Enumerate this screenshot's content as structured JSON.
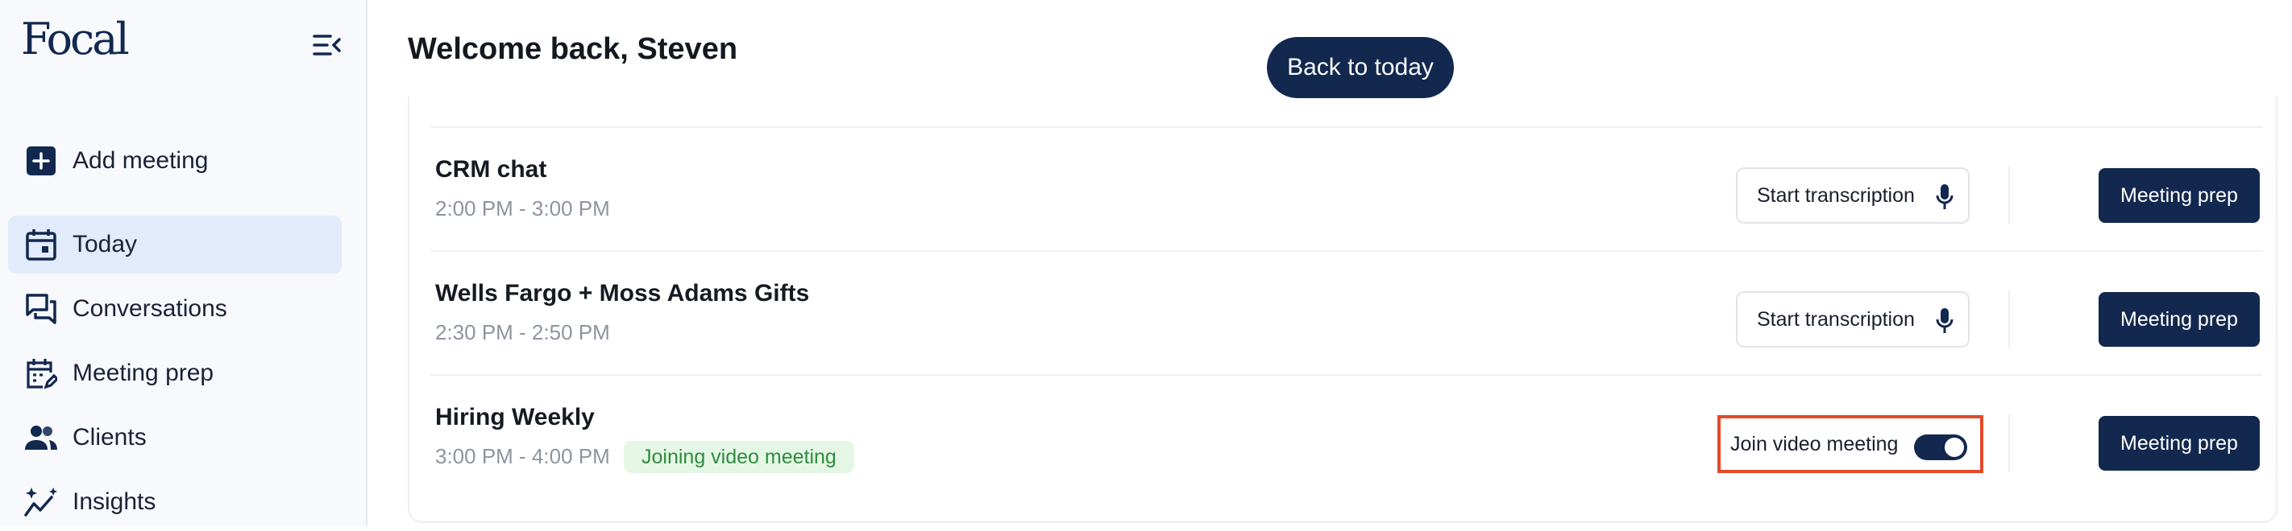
{
  "app": {
    "logo_text": "Focal"
  },
  "sidebar": {
    "items": [
      {
        "label": "Add meeting",
        "icon": "plus-square-icon"
      },
      {
        "label": "Today",
        "icon": "calendar-icon",
        "active": true
      },
      {
        "label": "Conversations",
        "icon": "chat-icon"
      },
      {
        "label": "Meeting prep",
        "icon": "calendar-edit-icon"
      },
      {
        "label": "Clients",
        "icon": "users-icon"
      },
      {
        "label": "Insights",
        "icon": "sparkle-chart-icon"
      }
    ]
  },
  "header": {
    "title": "Welcome back, Steven",
    "back_button": "Back to today"
  },
  "meetings": [
    {
      "title": "CRM chat",
      "time": "2:00 PM - 3:00 PM",
      "action": "Start transcription",
      "prep": "Meeting prep"
    },
    {
      "title": "Wells Fargo + Moss Adams Gifts",
      "time": "2:30 PM - 2:50 PM",
      "action": "Start transcription",
      "prep": "Meeting prep"
    },
    {
      "title": "Hiring Weekly",
      "time": "3:00 PM - 4:00 PM",
      "badge": "Joining video meeting",
      "action": "Join video meeting",
      "toggle_on": true,
      "prep": "Meeting prep"
    }
  ],
  "colors": {
    "brand": "#13284f",
    "active_nav": "#e2ebfb",
    "badge_bg": "#e4f7e6",
    "badge_text": "#2f8b3c",
    "highlight": "#e34a2a"
  }
}
